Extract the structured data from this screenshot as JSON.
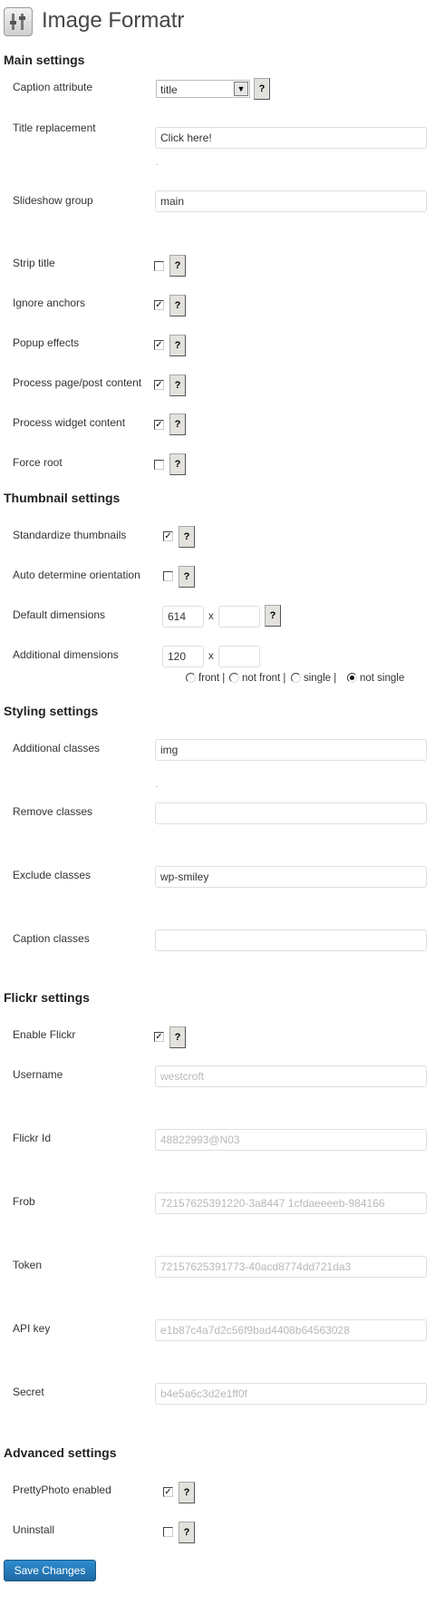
{
  "app": {
    "title": "Image Formatr",
    "icon": "settings-sliders-icon"
  },
  "sections": {
    "main": "Main settings",
    "thumbnail": "Thumbnail settings",
    "styling": "Styling settings",
    "flickr": "Flickr settings",
    "advanced": "Advanced settings"
  },
  "main": {
    "caption_attribute": {
      "label": "Caption attribute",
      "value": "title"
    },
    "title_replacement": {
      "label": "Title replacement",
      "value": "Click here!"
    },
    "slideshow_group": {
      "label": "Slideshow group",
      "value": "main"
    },
    "strip_title": {
      "label": "Strip title",
      "checked": false
    },
    "ignore_anchors": {
      "label": "Ignore anchors",
      "checked": true
    },
    "popup_effects": {
      "label": "Popup effects",
      "checked": true
    },
    "process_content": {
      "label": "Process page/post content",
      "checked": true
    },
    "process_widget": {
      "label": "Process widget content",
      "checked": true
    },
    "force_root": {
      "label": "Force root",
      "checked": false
    }
  },
  "thumbnail": {
    "standardize": {
      "label": "Standardize thumbnails",
      "checked": true
    },
    "auto_orientation": {
      "label": "Auto determine orientation",
      "checked": false
    },
    "default_dimensions": {
      "label": "Default dimensions",
      "width": "614",
      "height": "",
      "x": "x"
    },
    "additional_dimensions": {
      "label": "Additional dimensions",
      "width": "120",
      "height": "",
      "x": "x"
    },
    "scope_options": [
      {
        "label": "front |",
        "selected": false
      },
      {
        "label": "not front |",
        "selected": false
      },
      {
        "label": "single |",
        "selected": false
      },
      {
        "label": "not single",
        "selected": true
      }
    ]
  },
  "styling": {
    "additional_classes": {
      "label": "Additional classes",
      "value": "img"
    },
    "remove_classes": {
      "label": "Remove classes",
      "value": ""
    },
    "exclude_classes": {
      "label": "Exclude classes",
      "value": "wp-smiley"
    },
    "caption_classes": {
      "label": "Caption classes",
      "value": ""
    }
  },
  "flickr": {
    "enable": {
      "label": "Enable Flickr",
      "checked": true
    },
    "username": {
      "label": "Username",
      "value": "westcroft"
    },
    "flickr_id": {
      "label": "Flickr Id",
      "value": "48822993@N03"
    },
    "frob": {
      "label": "Frob",
      "value": "72157625391220-3a8447 1cfdaeeeeb-984166"
    },
    "token": {
      "label": "Token",
      "value": "72157625391773-40acd8774dd721da3"
    },
    "api_key": {
      "label": "API key",
      "value": "e1b87c4a7d2c56f9bad4408b64563028"
    },
    "secret": {
      "label": "Secret",
      "value": "b4e5a6c3d2e1ff0f"
    }
  },
  "advanced": {
    "prettyphoto": {
      "label": "PrettyPhoto enabled",
      "checked": true
    },
    "uninstall": {
      "label": "Uninstall",
      "checked": false
    }
  },
  "help_label": "?",
  "save_label": "Save Changes",
  "colors": {
    "primary_button": "#2271b1",
    "text": "#333333",
    "input_border": "#dfdfdf"
  }
}
